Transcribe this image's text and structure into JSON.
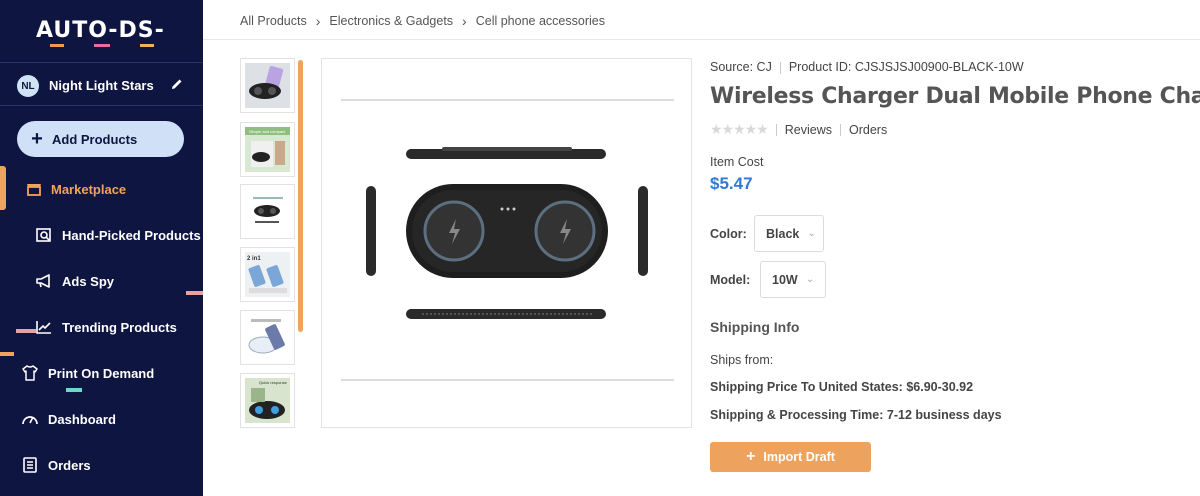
{
  "logo": "AUTO-DS-",
  "store": {
    "initials": "NL",
    "name": "Night Light Stars"
  },
  "sidebar": {
    "add_label": "Add Products",
    "items": [
      {
        "label": "Marketplace",
        "icon": "store-icon",
        "active": true
      },
      {
        "label": "Hand-Picked Products",
        "icon": "search-box-icon"
      },
      {
        "label": "Ads Spy",
        "icon": "megaphone-icon"
      },
      {
        "label": "Trending Products",
        "icon": "trending-chart-icon"
      },
      {
        "label": "Print On Demand",
        "icon": "tshirt-icon"
      },
      {
        "label": "Dashboard",
        "icon": "gauge-icon"
      },
      {
        "label": "Orders",
        "icon": "orders-list-icon"
      }
    ]
  },
  "breadcrumb": [
    "All Products",
    "Electronics & Gadgets",
    "Cell phone accessories"
  ],
  "product": {
    "source_label": "Source: CJ",
    "product_id_label": "Product ID: CJSJSJSJ00900-BLACK-10W",
    "title": "Wireless Charger Dual Mobile Phone Charger",
    "reviews_label": "Reviews",
    "orders_label": "Orders",
    "item_cost_label": "Item Cost",
    "item_cost": "$5.47",
    "color_label": "Color:",
    "color_value": "Black",
    "model_label": "Model:",
    "model_value": "10W",
    "shipping_info_label": "Shipping Info",
    "ships_from_label": "Ships from:",
    "shipping_price_label": "Shipping Price To United States:",
    "shipping_price": "$6.90-30.92",
    "processing_label": "Shipping & Processing Time:",
    "processing_time": "7-12 business days",
    "import_label": "Import Draft"
  },
  "thumb_texts": [
    "",
    "Simple and compact",
    "",
    "2 in1",
    "",
    "Quick response"
  ],
  "colors": {
    "sidebar_bg": "#0f1541",
    "accent_orange": "#f0a35c",
    "price_blue": "#2f7ad6"
  }
}
